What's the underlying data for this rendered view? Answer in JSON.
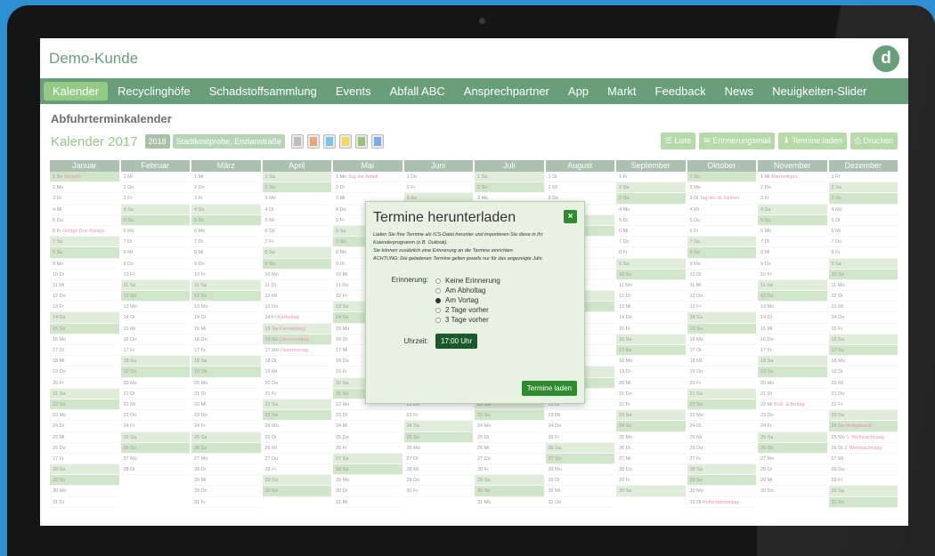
{
  "header": {
    "brand": "Demo-Kunde",
    "logo_letter": "d"
  },
  "nav": [
    "Kalender",
    "Recyclinghöfe",
    "Schadstoffsammlung",
    "Events",
    "Abfall ABC",
    "Ansprechpartner",
    "App",
    "Markt",
    "Feedback",
    "News",
    "Neuigkeiten-Slider"
  ],
  "page_title": "Abfuhrterminkalender",
  "toolbar": {
    "title": "Kalender 2017",
    "year_btn": "2018",
    "location": "Stadtkostprobe, Enzianstraße",
    "buttons": [
      "Liste",
      "Erinnerungsmail",
      "Termine laden",
      "Drucken"
    ],
    "icon_colors": [
      "#9a9a9a",
      "#d97b2b",
      "#33a5d6",
      "#f0c400",
      "#6a9f3a",
      "#3a7fd6"
    ]
  },
  "months": [
    "Januar",
    "Februar",
    "März",
    "April",
    "Mai",
    "Juni",
    "Juli",
    "August",
    "September",
    "Oktober",
    "November",
    "Dezember"
  ],
  "holidays": {
    "Januar": {
      "1": "Neujahr",
      "6": "Heilige Drei Könige"
    },
    "April": {
      "14": "Karfreitag",
      "15": "Karsamstag",
      "16": "Ostersonntag",
      "17": "Ostermontag"
    },
    "Mai": {
      "1": "Tag der Arbeit"
    },
    "Oktober": {
      "3": "Tag der dt. Einheit",
      "31": "Reformationstag"
    },
    "November": {
      "1": "Allerheiligen",
      "22": "Buß- & Bettag"
    },
    "Dezember": {
      "24": "Heiligabend",
      "25": "1. Weihnachtstag",
      "26": "2. Weihnachtstag"
    }
  },
  "modal": {
    "title": "Termine herunterladen",
    "close": "×",
    "text1": "Laden Sie Ihre Termine als ICS-Datei herunter und importieren Sie diese in Ihr Kalenderprogramm (z.B. Outlook).",
    "text2": "Sie können zusätzlich eine Erinnerung an die Termine einrichten.",
    "text3": "ACHTUNG: Die geladenen Termine gelten jeweils nur für das angezeigte Jahr.",
    "reminder_label": "Erinnerung:",
    "reminder_options": [
      "Keine Erinnerung",
      "Am Abholtag",
      "Am Vortag",
      "2 Tage vorher",
      "3 Tage vorher"
    ],
    "reminder_selected": 2,
    "time_label": "Uhrzeit:",
    "time_value": "17:00 Uhr",
    "load_button": "Termine laden"
  }
}
